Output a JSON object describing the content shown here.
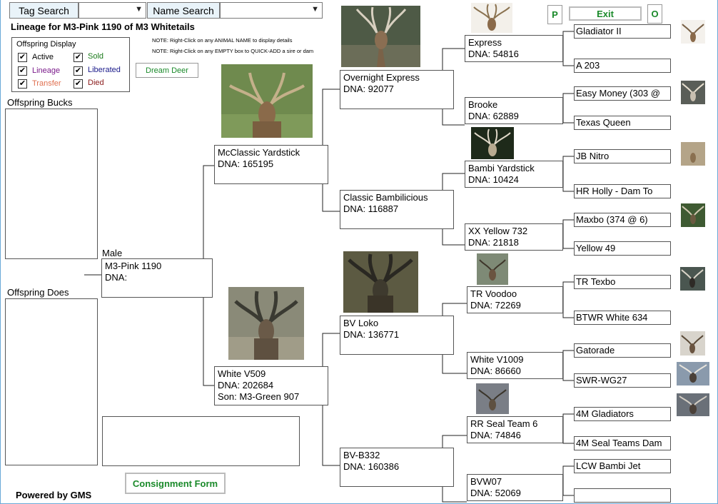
{
  "search": {
    "tag_label": "Tag Search",
    "name_label": "Name Search",
    "tag_value": "",
    "name_value": ""
  },
  "header": {
    "title": "Lineage for M3-Pink 1190 of M3 Whitetails",
    "note1": "NOTE: Right-Click on any ANIMAL NAME to display details",
    "note2": "NOTE: Right-Click on any EMPTY box to QUICK-ADD a sire or dam"
  },
  "legend": {
    "title": "Offspring Display",
    "items": [
      {
        "label": "Active",
        "color": "#000000",
        "checked": true
      },
      {
        "label": "Sold",
        "color": "#1a7a1a",
        "checked": true
      },
      {
        "label": "Lineage",
        "color": "#7a1a8a",
        "checked": true
      },
      {
        "label": "Liberated",
        "color": "#1a1a8a",
        "checked": true
      },
      {
        "label": "Transfer",
        "color": "#e07050",
        "checked": true
      },
      {
        "label": "Died",
        "color": "#8a1a1a",
        "checked": true
      }
    ]
  },
  "buttons": {
    "dream_deer": "Dream Deer",
    "p": "P",
    "exit": "Exit",
    "o": "O",
    "consignment": "Consignment Form"
  },
  "offspring": {
    "bucks_label": "Offspring Bucks",
    "does_label": "Offspring Does"
  },
  "footer": {
    "powered": "Powered by GMS"
  },
  "subject": {
    "sex_label": "Male",
    "name": "M3-Pink 1190",
    "dna": "DNA:"
  },
  "gen1": {
    "sire": {
      "name": "McClassic Yardstick",
      "dna": "DNA:  165195"
    },
    "dam": {
      "name": "White V509",
      "dna": "DNA:  202684",
      "extra": "Son: M3-Green 907"
    }
  },
  "gen2": [
    {
      "name": "Overnight Express",
      "dna": "DNA:  92077"
    },
    {
      "name": "Classic Bambilicious",
      "dna": "DNA:  116887"
    },
    {
      "name": "BV Loko",
      "dna": "DNA:  136771"
    },
    {
      "name": "BV-B332",
      "dna": "DNA:  160386"
    }
  ],
  "gen3": [
    {
      "name": "Express",
      "dna": "DNA:  54816"
    },
    {
      "name": "Brooke",
      "dna": "DNA:  62889"
    },
    {
      "name": "Bambi Yardstick",
      "dna": "DNA:  10424"
    },
    {
      "name": "XX Yellow 732",
      "dna": "DNA:  21818"
    },
    {
      "name": "TR Voodoo",
      "dna": "DNA:  72269"
    },
    {
      "name": "White V1009",
      "dna": "DNA:  86660"
    },
    {
      "name": "RR Seal Team 6",
      "dna": "DNA:  74846"
    },
    {
      "name": "BVW07",
      "dna": "DNA:  52069"
    }
  ],
  "gen4": [
    {
      "name": "Gladiator II"
    },
    {
      "name": "A 203"
    },
    {
      "name": "Easy Money (303 @"
    },
    {
      "name": "Texas Queen"
    },
    {
      "name": "JB Nitro"
    },
    {
      "name": "HR Holly - Dam To"
    },
    {
      "name": "Maxbo (374 @ 6)"
    },
    {
      "name": "Yellow 49"
    },
    {
      "name": "TR Texbo"
    },
    {
      "name": "BTWR White 634"
    },
    {
      "name": "Gatorade"
    },
    {
      "name": "SWR-WG27"
    },
    {
      "name": "4M Gladiators"
    },
    {
      "name": "4M Seal Teams Dam"
    },
    {
      "name": "LCW Bambi Jet"
    },
    {
      "name": ""
    }
  ]
}
